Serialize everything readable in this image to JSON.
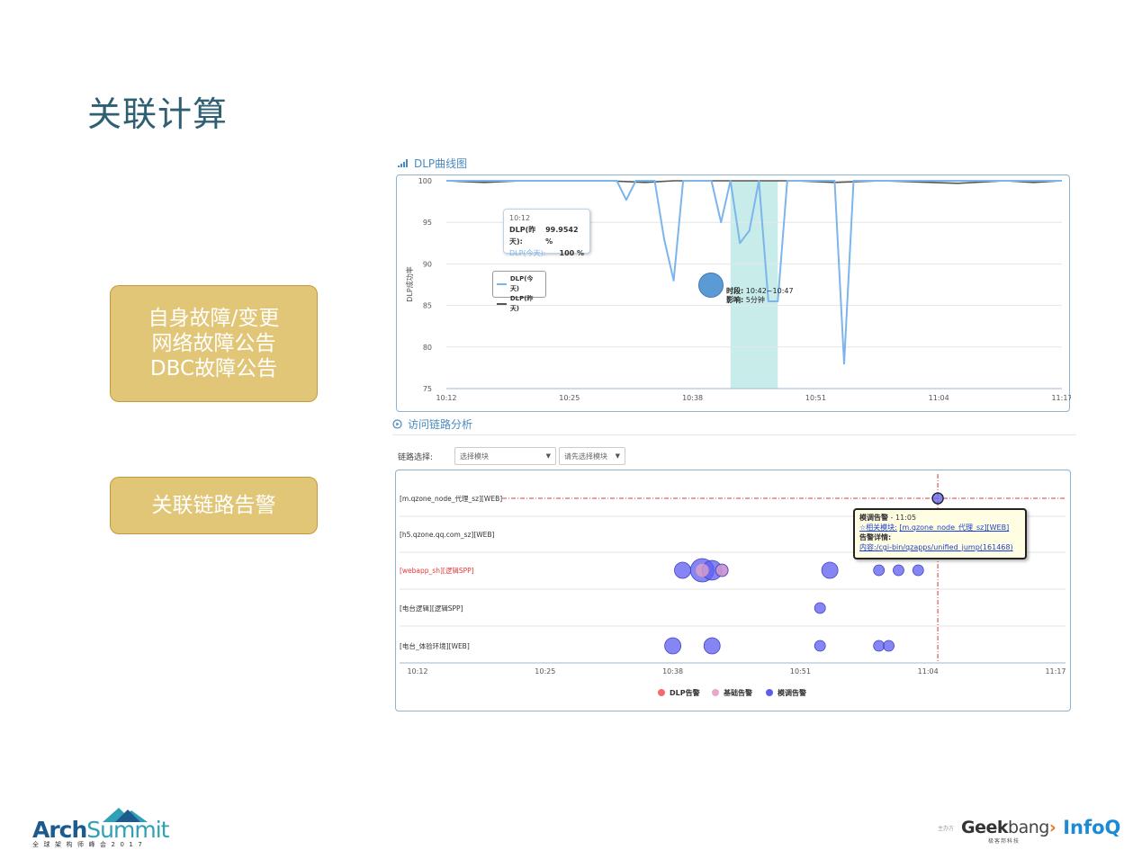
{
  "slide": {
    "title": "关联计算"
  },
  "callouts": {
    "first": [
      "自身故障/变更",
      "网络故障公告",
      "DBC故障公告"
    ],
    "second": "关联链路告警"
  },
  "dlp_section": {
    "title": "DLP曲线图",
    "ylabel": "DLP成功率",
    "tooltip": {
      "time": "10:12",
      "yesterday_label": "DLP(昨天):",
      "yesterday_value": "99.9542 %",
      "today_label": "DLP(今天):",
      "today_value": "100 %"
    },
    "legend": [
      "DLP(今天)",
      "DLP(昨天)"
    ],
    "impact": {
      "period_label": "时段:",
      "period_value": "10:42~10:47",
      "impact_label": "影响:",
      "impact_value": "5分钟"
    },
    "colors": {
      "today": "#7cb5ec",
      "yesterday": "#555555",
      "band": "#c8ecea",
      "marker": "#5b9bd5"
    }
  },
  "link_section": {
    "title": "访问链路分析",
    "select_label": "链路选择:",
    "select1": "选择模块",
    "select2": "请先选择模块",
    "tooltip": {
      "title": "模调告警",
      "time": "11:05",
      "related_label": "☆相关模块:",
      "related_value": "[m.qzone_node_代理_sz][WEB]",
      "detail_label": "告警详情:",
      "detail_value": "内容:/cgi-bin/qzapps/unified_jump(161468)"
    },
    "legend": [
      "DLP告警",
      "基础告警",
      "模调告警"
    ],
    "colors": {
      "dlp": "#f7696b",
      "basic": "#e8a6c8",
      "modcall": "#5c5ef0"
    }
  },
  "chart_data": [
    {
      "type": "line",
      "title": "DLP曲线图",
      "ylabel": "DLP成功率",
      "xlabel": "",
      "x_ticks": [
        "10:12",
        "10:25",
        "10:38",
        "10:51",
        "11:04",
        "11:17"
      ],
      "y_ticks": [
        100,
        95,
        90,
        85,
        80,
        75
      ],
      "ylim": [
        75,
        100
      ],
      "xlim": [
        "10:12",
        "11:17"
      ],
      "grid": true,
      "highlight_band": [
        "10:42",
        "10:47"
      ],
      "series": [
        {
          "name": "DLP(今天)",
          "points": [
            [
              "10:12",
              100
            ],
            [
              "10:30",
              100
            ],
            [
              "10:31",
              97.7
            ],
            [
              "10:32",
              100
            ],
            [
              "10:34",
              100
            ],
            [
              "10:35",
              93
            ],
            [
              "10:36",
              88
            ],
            [
              "10:37",
              100
            ],
            [
              "10:39",
              100
            ],
            [
              "10:40",
              100
            ],
            [
              "10:41",
              95
            ],
            [
              "10:42",
              100
            ],
            [
              "10:43",
              92.5
            ],
            [
              "10:44",
              94
            ],
            [
              "10:45",
              100
            ],
            [
              "10:46",
              85.5
            ],
            [
              "10:47",
              85.5
            ],
            [
              "10:48",
              100
            ],
            [
              "10:52",
              100
            ],
            [
              "10:53",
              100
            ],
            [
              "10:54",
              78
            ],
            [
              "10:55",
              100
            ],
            [
              "11:17",
              100
            ]
          ]
        },
        {
          "name": "DLP(昨天)",
          "points": [
            [
              "10:12",
              100
            ],
            [
              "10:16",
              99.8
            ],
            [
              "10:20",
              100
            ],
            [
              "10:29",
              100
            ],
            [
              "10:33",
              99.8
            ],
            [
              "10:36",
              100
            ],
            [
              "10:49",
              100
            ],
            [
              "10:53",
              99.8
            ],
            [
              "10:58",
              100
            ],
            [
              "11:06",
              99.7
            ],
            [
              "11:11",
              100
            ],
            [
              "11:14",
              99.8
            ],
            [
              "11:17",
              100
            ]
          ]
        }
      ]
    },
    {
      "type": "scatter",
      "title": "访问链路分析",
      "x_ticks": [
        "10:12",
        "10:25",
        "10:38",
        "10:51",
        "11:04",
        "11:17"
      ],
      "xlim": [
        "10:12",
        "11:17"
      ],
      "categories": [
        "[m.qzone_node_代理_sz][WEB]",
        "[h5.qzone.qq.com_sz][WEB]",
        "[webapp_sh][逻辑SPP]",
        "[电台逻辑][逻辑SPP]",
        "[电台_体验环境][WEB]"
      ],
      "highlight_category": "[webapp_sh][逻辑SPP]",
      "series": [
        {
          "name": "模调告警",
          "points": [
            {
              "x": "11:05",
              "row": "[m.qzone_node_代理_sz][WEB]",
              "size": 6
            },
            {
              "x": "10:39",
              "row": "[webapp_sh][逻辑SPP]",
              "size": 9
            },
            {
              "x": "10:41",
              "row": "[webapp_sh][逻辑SPP]",
              "size": 13
            },
            {
              "x": "10:42",
              "row": "[webapp_sh][逻辑SPP]",
              "size": 11
            },
            {
              "x": "10:43",
              "row": "[webapp_sh][逻辑SPP]",
              "size": 7
            },
            {
              "x": "10:54",
              "row": "[webapp_sh][逻辑SPP]",
              "size": 9
            },
            {
              "x": "10:59",
              "row": "[webapp_sh][逻辑SPP]",
              "size": 6
            },
            {
              "x": "11:01",
              "row": "[webapp_sh][逻辑SPP]",
              "size": 6
            },
            {
              "x": "11:03",
              "row": "[webapp_sh][逻辑SPP]",
              "size": 6
            },
            {
              "x": "10:53",
              "row": "[电台逻辑][逻辑SPP]",
              "size": 6
            },
            {
              "x": "10:38",
              "row": "[电台_体验环境][WEB]",
              "size": 9
            },
            {
              "x": "10:42",
              "row": "[电台_体验环境][WEB]",
              "size": 9
            },
            {
              "x": "10:53",
              "row": "[电台_体验环境][WEB]",
              "size": 6
            },
            {
              "x": "10:59",
              "row": "[电台_体验环境][WEB]",
              "size": 6
            },
            {
              "x": "11:00",
              "row": "[电台_体验环境][WEB]",
              "size": 6
            }
          ]
        },
        {
          "name": "基础告警",
          "points": [
            {
              "x": "10:41",
              "row": "[webapp_sh][逻辑SPP]",
              "size": 7
            },
            {
              "x": "10:43",
              "row": "[webapp_sh][逻辑SPP]",
              "size": 6
            }
          ]
        },
        {
          "name": "DLP告警",
          "points": []
        }
      ],
      "marker_line": "11:05"
    }
  ],
  "footer": {
    "arch_brand": "Arch",
    "arch_brand2": "Summit",
    "arch_sub": "全球架构师峰会2017",
    "host_label": "主办方",
    "geek": "Geek",
    "bang": "bang",
    "chevron": "›",
    "geek_sub": "极客邦科技",
    "infoq": "InfoQ"
  }
}
